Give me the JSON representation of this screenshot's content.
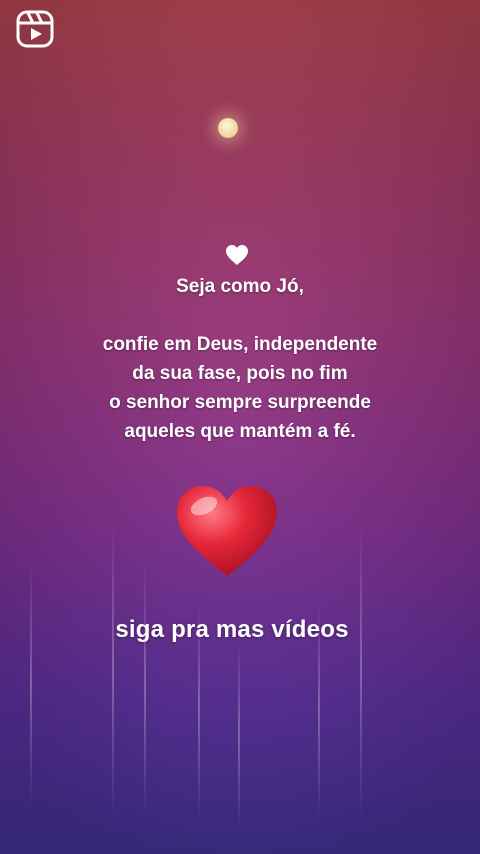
{
  "icons": {
    "top_left": "instagram-reels-icon",
    "small_heart": "white-heart-icon",
    "big_heart": "red-heart-icon"
  },
  "text": {
    "line1": "Seja como Jó,",
    "line2": "confie em Deus, independente",
    "line3": "da sua fase, pois no fim",
    "line4": "o senhor sempre surpreende",
    "line5": "aqueles que mantém a fé.",
    "cta": "siga pra mas vídeos"
  },
  "colors": {
    "heart_red": "#e02a3a",
    "text": "#ffffff",
    "bg_top": "#b0434f",
    "bg_bottom": "#3f2f8f"
  }
}
